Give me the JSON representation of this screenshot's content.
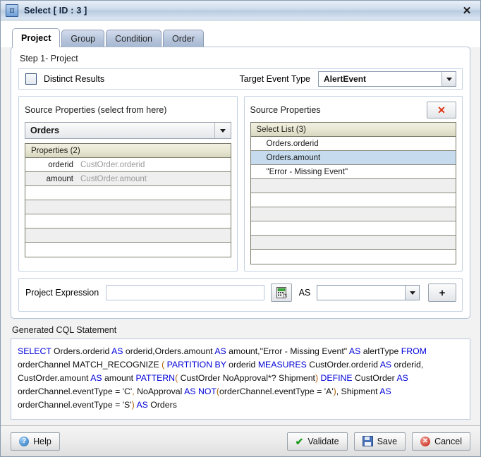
{
  "window": {
    "title": "Select [ ID : 3 ]",
    "icon": "pi-icon",
    "icon_glyph": "π",
    "close_label": "✕"
  },
  "tabs": [
    {
      "label": "Project",
      "active": true
    },
    {
      "label": "Group",
      "active": false
    },
    {
      "label": "Condition",
      "active": false
    },
    {
      "label": "Order",
      "active": false
    }
  ],
  "project": {
    "step_label": "Step 1- Project",
    "distinct_results_label": "Distinct Results",
    "distinct_results_checked": false,
    "target_event_type_label": "Target Event Type",
    "target_event_type_value": "AlertEvent"
  },
  "source_panel": {
    "title": "Source Properties (select from here)",
    "source_combo_value": "Orders",
    "grid_header": "Properties (2)",
    "rows": [
      {
        "name": "orderid",
        "value": "CustOrder.orderid"
      },
      {
        "name": "amount",
        "value": "CustOrder.amount"
      },
      {
        "name": "",
        "value": ""
      },
      {
        "name": "",
        "value": ""
      },
      {
        "name": "",
        "value": ""
      },
      {
        "name": "",
        "value": ""
      },
      {
        "name": "",
        "value": ""
      }
    ]
  },
  "select_panel": {
    "title": "Source Properties",
    "delete_label": "✕",
    "grid_header": "Select List (3)",
    "rows": [
      {
        "text": "Orders.orderid",
        "selected": false
      },
      {
        "text": "Orders.amount",
        "selected": true
      },
      {
        "text": "\"Error - Missing Event\"",
        "selected": false
      },
      {
        "text": "",
        "selected": false
      },
      {
        "text": "",
        "selected": false
      },
      {
        "text": "",
        "selected": false
      },
      {
        "text": "",
        "selected": false
      },
      {
        "text": "",
        "selected": false
      },
      {
        "text": "",
        "selected": false
      }
    ]
  },
  "expression": {
    "label": "Project Expression",
    "input_value": "",
    "input_placeholder": "",
    "builder_icon": "calculator-fx-icon",
    "as_label": "AS",
    "as_value": "",
    "add_label": "+"
  },
  "cql": {
    "label": "Generated CQL Statement",
    "tokens": [
      {
        "t": "SELECT",
        "k": "kw"
      },
      {
        "t": " Orders.orderid ",
        "k": ""
      },
      {
        "t": "AS",
        "k": "kw"
      },
      {
        "t": " orderid,Orders.amount ",
        "k": ""
      },
      {
        "t": "AS",
        "k": "kw"
      },
      {
        "t": " amount,\"Error - Missing Event\" ",
        "k": ""
      },
      {
        "t": "AS",
        "k": "kw"
      },
      {
        "t": " alertType ",
        "k": ""
      },
      {
        "t": "FROM",
        "k": "kw"
      },
      {
        "t": " orderChannel MATCH_RECOGNIZE ",
        "k": ""
      },
      {
        "t": "(",
        "k": "pn"
      },
      {
        "t": " ",
        "k": ""
      },
      {
        "t": "PARTITION BY",
        "k": "kw"
      },
      {
        "t": " orderid ",
        "k": ""
      },
      {
        "t": "MEASURES",
        "k": "kw"
      },
      {
        "t": " CustOrder.orderid ",
        "k": ""
      },
      {
        "t": "AS",
        "k": "kw"
      },
      {
        "t": " orderid, CustOrder.amount ",
        "k": ""
      },
      {
        "t": "AS",
        "k": "kw"
      },
      {
        "t": " amount ",
        "k": ""
      },
      {
        "t": "PATTERN",
        "k": "kw"
      },
      {
        "t": "(",
        "k": "pn"
      },
      {
        "t": " CustOrder NoApproval*? Shipment",
        "k": ""
      },
      {
        "t": ")",
        "k": "pn"
      },
      {
        "t": " ",
        "k": ""
      },
      {
        "t": "DEFINE",
        "k": "kw"
      },
      {
        "t": " CustOrder ",
        "k": ""
      },
      {
        "t": "AS",
        "k": "kw"
      },
      {
        "t": " orderChannel.eventType = 'C'",
        "k": ""
      },
      {
        "t": ",",
        "k": "pn"
      },
      {
        "t": " NoApproval ",
        "k": ""
      },
      {
        "t": "AS",
        "k": "kw"
      },
      {
        "t": " ",
        "k": ""
      },
      {
        "t": "NOT",
        "k": "kw"
      },
      {
        "t": "(",
        "k": "pn"
      },
      {
        "t": "orderChannel.eventType = 'A'",
        "k": ""
      },
      {
        "t": ")",
        "k": "pn"
      },
      {
        "t": ", Shipment ",
        "k": ""
      },
      {
        "t": "AS",
        "k": "kw"
      },
      {
        "t": " orderChannel.eventType = 'S'",
        "k": ""
      },
      {
        "t": ")",
        "k": "pn"
      },
      {
        "t": " ",
        "k": ""
      },
      {
        "t": "AS",
        "k": "kw"
      },
      {
        "t": " Orders",
        "k": ""
      }
    ]
  },
  "footer": {
    "help_label": "Help",
    "help_glyph": "?",
    "validate_label": "Validate",
    "validate_glyph": "✔",
    "save_label": "Save",
    "cancel_label": "Cancel",
    "cancel_glyph": "✕"
  },
  "colors": {
    "titlebar_accent": "#b9cbe0",
    "selected_row": "#c6dcee",
    "keyword": "#0000d8",
    "paren": "#b06000",
    "delete_x": "#e03010"
  }
}
